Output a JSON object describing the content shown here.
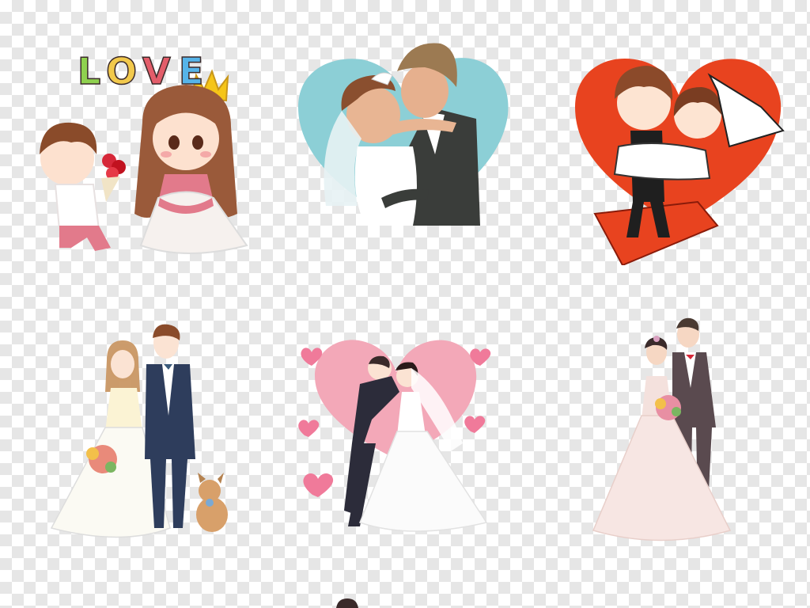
{
  "love_text": {
    "letters": [
      {
        "char": "L",
        "color": "#8fd14f"
      },
      {
        "char": "O",
        "color": "#f2c94c"
      },
      {
        "char": "V",
        "color": "#e35d6a"
      },
      {
        "char": "E",
        "color": "#56b4e9"
      }
    ]
  },
  "tiles": [
    {
      "name": "proposal-couple",
      "accent": "#e27a8b"
    },
    {
      "name": "kissing-couple",
      "accent": "#8ccfd6"
    },
    {
      "name": "carrying-bride",
      "accent": "#e8431f"
    },
    {
      "name": "couple-with-dog",
      "accent": "#2e3d5c"
    },
    {
      "name": "couple-pink-hearts",
      "accent": "#f07a9a"
    },
    {
      "name": "couple-bouquet",
      "accent": "#5a4a4f"
    }
  ]
}
